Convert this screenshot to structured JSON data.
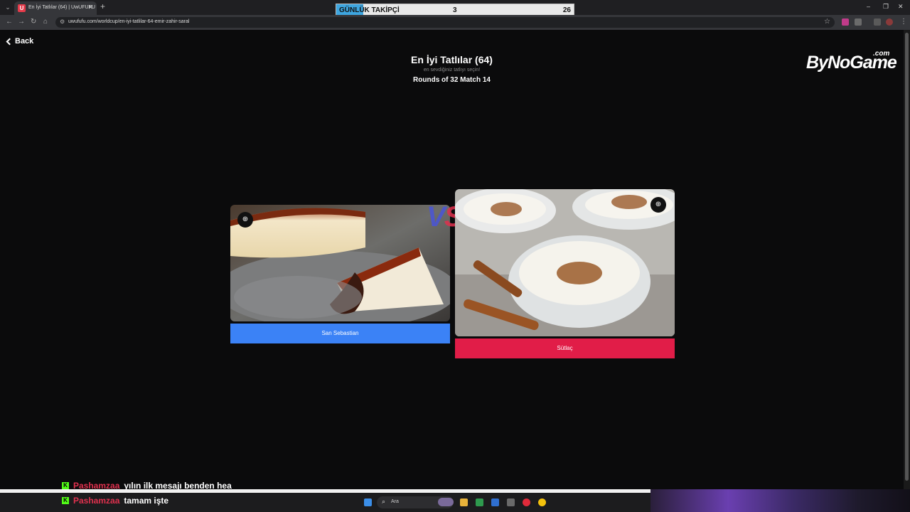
{
  "browser": {
    "tab_title": "En İyi Tatlılar (64) | UwUFUFU",
    "tab_favicon_letter": "U",
    "url": "uwufufu.com/worldcup/en-iyi-tatlilar-64-emir-zahir-saral"
  },
  "follower_goal": {
    "label": "GÜNLÜK TAKİPÇİ",
    "current": "3",
    "goal": "26",
    "progress_fraction": 0.115
  },
  "page": {
    "back_label": "Back",
    "title": "En İyi Tatlılar (64)",
    "subtitle": "en sevdiğiniz tatlıyı seçin!",
    "round": "Rounds of 32 Match 14",
    "brand": "ByNoGame",
    "brand_suffix": ".com"
  },
  "matchup": {
    "vs_text_v": "V",
    "vs_text_s": "S",
    "left": {
      "name": "San Sebastian",
      "button_color": "#3b82f6"
    },
    "right": {
      "name": "Sütlaç",
      "button_color": "#e11d48"
    }
  },
  "chat": [
    {
      "user": "Pashamzaa",
      "message": "yılın ilk mesajı benden hea"
    },
    {
      "user": "Pashamzaa",
      "message": "tamam işte"
    }
  ],
  "taskbar": {
    "search_placeholder": "Ara"
  }
}
